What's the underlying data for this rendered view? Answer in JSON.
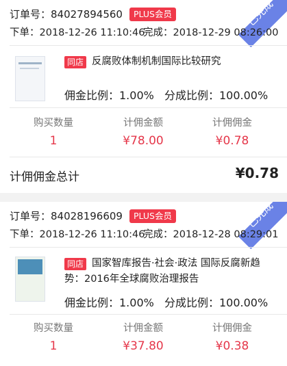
{
  "orders": [
    {
      "order_label": "订单号：84027894560",
      "plus_badge": "PLUS会员",
      "ribbon": "已完成",
      "order_time": "下单：2018-12-26 11:10:46",
      "done_time": "完成：2018-12-29 08:26:00",
      "shop_tag": "同店",
      "product_title": "反腐败体制机制国际比较研究",
      "commission_rate": "佣金比例：1.00%",
      "split_rate": "分成比例：100.00%",
      "stats": [
        {
          "label": "购买数量",
          "value": "1"
        },
        {
          "label": "计佣金额",
          "value": "¥78.00"
        },
        {
          "label": "计佣佣金",
          "value": "¥0.78"
        }
      ],
      "total_label": "计佣佣金总计",
      "total_value": "¥0.78"
    },
    {
      "order_label": "订单号：84028196609",
      "plus_badge": "PLUS会员",
      "ribbon": "已完成",
      "order_time": "下单：2018-12-26 11:10:46",
      "done_time": "完成：2018-12-28 08:29:01",
      "shop_tag": "同店",
      "product_title": "国家智库报告·社会·政法 国际反腐新趋势：2016年全球腐败治理报告",
      "commission_rate": "佣金比例：1.00%",
      "split_rate": "分成比例：100.00%",
      "stats": [
        {
          "label": "购买数量",
          "value": "1"
        },
        {
          "label": "计佣金额",
          "value": "¥37.80"
        },
        {
          "label": "计佣佣金",
          "value": "¥0.38"
        }
      ]
    }
  ],
  "colors": {
    "accent": "#f0394a",
    "ribbon": "#6a82e6",
    "value_red": "#e5374a"
  }
}
